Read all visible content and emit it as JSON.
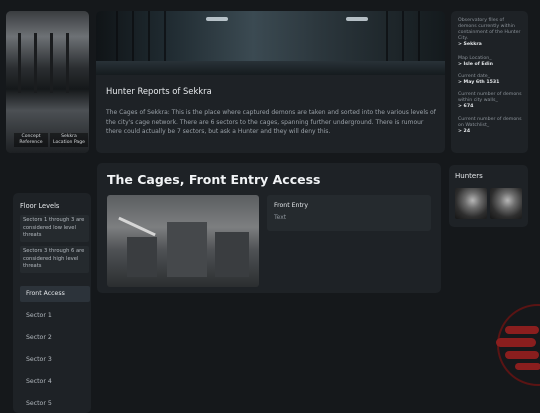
{
  "photo_card": {
    "captions": [
      "Concept Reference",
      "Sekkra Location Page"
    ]
  },
  "report": {
    "title": "Hunter Reports of Sekkra",
    "body": "The Cages of Sekkra: This is the place where captured demons are taken and sorted into the various levels of the city's cage network. There are 6 sectors to the cages, spanning further underground. There is rumour there could actually be 7 sectors, but ask a Hunter and they will deny this."
  },
  "info": {
    "observatory_label": "Observatory files of demons currently within containment of the Hunter City.",
    "observatory_value": "> Sekkra",
    "location_label": "Map Location_",
    "location_value": "> Isle of Edin",
    "date_label": "Current date_",
    "date_value": "> May 6th 1531",
    "cage_count_label": "Current number of demons within city walls_",
    "cage_count_value": "> 674",
    "watchlist_label": "Current number of demons on Watchlist_",
    "watchlist_value": "> 24"
  },
  "floor_levels": {
    "title": "Floor Levels",
    "notes": [
      "Sectors 1 through 3 are considered low level threats",
      "Sectors 3 through 6 are considered high level threats"
    ],
    "items": [
      "Front Access",
      "Sector 1",
      "Sector 2",
      "Sector 3",
      "Sector 4",
      "Sector 5"
    ],
    "active": "Front Access"
  },
  "cages": {
    "title": "The Cages, Front Entry Access",
    "entry_title": "Front Entry",
    "entry_text": "Text"
  },
  "hunters": {
    "title": "Hunters"
  },
  "colors": {
    "background": "#15181b",
    "panel": "#1e2226",
    "accent_red": "#8a1e1e"
  }
}
